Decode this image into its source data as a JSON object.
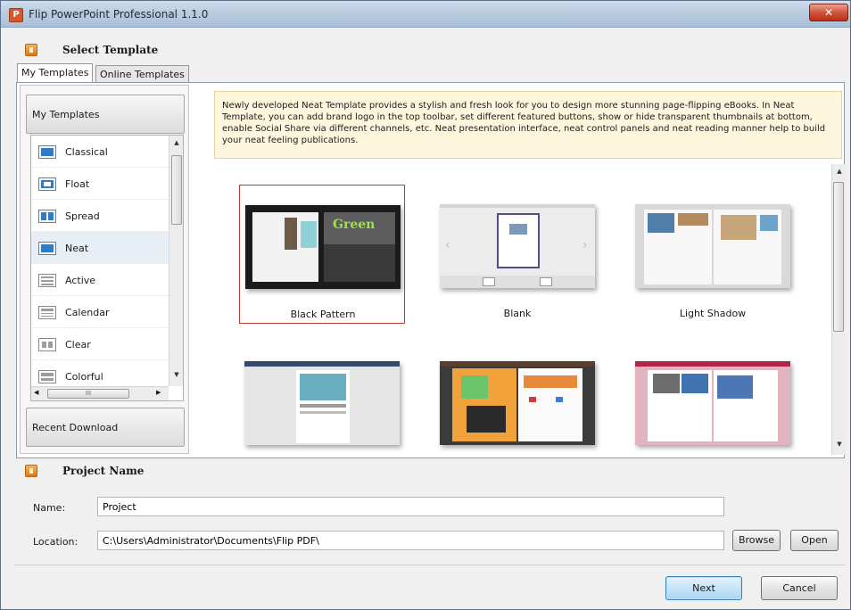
{
  "window": {
    "title": "Flip PowerPoint Professional 1.1.0",
    "app_icon_letter": "P",
    "close_glyph": "✕"
  },
  "select_template": {
    "title": "Select Template",
    "tabs": [
      {
        "label": "My Templates",
        "active": true
      },
      {
        "label": "Online Templates",
        "active": false
      }
    ],
    "groups": {
      "my_templates": "My Templates",
      "recent_download": "Recent Download"
    },
    "items": [
      {
        "label": "Classical",
        "icon": "classical-icon"
      },
      {
        "label": "Float",
        "icon": "float-icon"
      },
      {
        "label": "Spread",
        "icon": "spread-icon"
      },
      {
        "label": "Neat",
        "icon": "neat-icon",
        "selected": true
      },
      {
        "label": "Active",
        "icon": "active-icon"
      },
      {
        "label": "Calendar",
        "icon": "calendar-icon"
      },
      {
        "label": "Clear",
        "icon": "clear-icon"
      },
      {
        "label": "Colorful",
        "icon": "colorful-icon"
      }
    ],
    "hscroll_grip": "III",
    "description": "Newly developed Neat Template provides a stylish and fresh look for you to design more stunning page-flipping eBooks. In Neat Template, you can add brand logo in the top toolbar, set different featured buttons, show or hide transparent thumbnails at bottom, enable Social Share via different channels, etc. Neat presentation interface, neat control panels and neat reading manner help to build your neat feeling publications.",
    "thumbnails": [
      {
        "name": "Black Pattern",
        "selected": true
      },
      {
        "name": "Blank",
        "selected": false
      },
      {
        "name": "Light Shadow",
        "selected": false
      },
      {
        "name": "",
        "selected": false
      },
      {
        "name": "",
        "selected": false
      },
      {
        "name": "",
        "selected": false
      }
    ],
    "thumb_overlay_text": "Green"
  },
  "project": {
    "title": "Project Name",
    "name_label": "Name:",
    "name_value": "Project",
    "location_label": "Location:",
    "location_value": "C:\\Users\\Administrator\\Documents\\Flip PDF\\",
    "browse_label": "Browse",
    "open_label": "Open"
  },
  "footer": {
    "next_label": "Next",
    "cancel_label": "Cancel"
  },
  "colors": {
    "accent": "#d8572a",
    "selection_border": "#c0392b",
    "desc_bg": "#fdf5dc",
    "icon_blue": "#2e7bc6"
  }
}
